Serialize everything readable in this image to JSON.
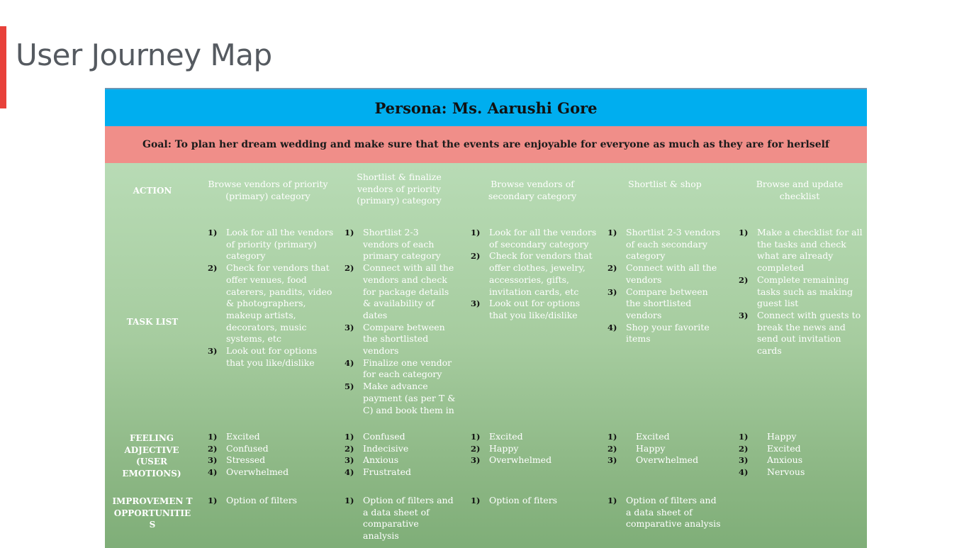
{
  "slide": {
    "title": "User Journey Map"
  },
  "persona": "Persona: Ms. Aarushi Gore",
  "goal": "Goal: To plan her dream wedding and make sure that the events are enjoyable for everyone as much as they are for herlself",
  "row_labels": {
    "action": "ACTION",
    "task_list": "TASK LIST",
    "feeling": "FEELING ADJECTIVE (USER EMOTIONS)",
    "improvement": "IMPROVEMEN T OPPORTUNITIE S"
  },
  "stages": [
    {
      "action": "Browse vendors of priority (primary) category",
      "tasks": [
        {
          "n": "1)",
          "t": "Look for all the vendors of priority (primary) category"
        },
        {
          "n": "2)",
          "t": "Check for vendors that offer venues, food caterers, pandits, video & photographers, makeup artists, decorators, music systems, etc"
        },
        {
          "n": "3)",
          "t": "Look out for options that you like/dislike"
        }
      ],
      "feelings": [
        {
          "n": "1)",
          "t": "Excited"
        },
        {
          "n": "2)",
          "t": "Confused"
        },
        {
          "n": "3)",
          "t": "Stressed"
        },
        {
          "n": "4)",
          "t": "Overwhelmed"
        }
      ],
      "improvements": [
        {
          "n": "1)",
          "t": "Option of filters"
        }
      ]
    },
    {
      "action": "Shortlist & finalize vendors of priority (primary) category",
      "tasks": [
        {
          "n": "1)",
          "t": "Shortlist 2-3 vendors of each primary category"
        },
        {
          "n": "2)",
          "t": "Connect with all the vendors and check for package details & availability of dates"
        },
        {
          "n": "3)",
          "t": "Compare between the shortlisted vendors"
        },
        {
          "n": "4)",
          "t": "Finalize one vendor for each category"
        },
        {
          "n": "5)",
          "t": "Make advance payment (as per T & C) and book them in"
        }
      ],
      "feelings": [
        {
          "n": "1)",
          "t": "Confused"
        },
        {
          "n": "2)",
          "t": "Indecisive"
        },
        {
          "n": "3)",
          "t": "Anxious"
        },
        {
          "n": "4)",
          "t": "Frustrated"
        }
      ],
      "improvements": [
        {
          "n": "1)",
          "t": "Option of filters and a data sheet of comparative analysis"
        }
      ]
    },
    {
      "action": "Browse vendors of secondary category",
      "tasks": [
        {
          "n": "1)",
          "t": "Look for all the vendors of secondary category"
        },
        {
          "n": "2)",
          "t": "Check for vendors that offer clothes, jewelry, accessories, gifts, invitation cards, etc"
        },
        {
          "n": "3)",
          "t": "Look out for options that you like/dislike"
        }
      ],
      "feelings": [
        {
          "n": "1)",
          "t": "Excited"
        },
        {
          "n": "2)",
          "t": "Happy"
        },
        {
          "n": "3)",
          "t": "Overwhelmed"
        }
      ],
      "improvements": [
        {
          "n": "1)",
          "t": "Option of fiters"
        }
      ]
    },
    {
      "action": "Shortlist & shop",
      "tasks": [
        {
          "n": "1)",
          "t": "Shortlist 2-3 vendors of each secondary category"
        },
        {
          "n": "2)",
          "t": "Connect with all the vendors"
        },
        {
          "n": "3)",
          "t": "Compare between the shortlisted vendors"
        },
        {
          "n": "4)",
          "t": "Shop your favorite items"
        }
      ],
      "feelings": [
        {
          "n": "1)",
          "t": "Excited"
        },
        {
          "n": "2)",
          "t": "Happy"
        },
        {
          "n": "3)",
          "t": "Overwhelmed"
        }
      ],
      "improvements": [
        {
          "n": "1)",
          "t": "Option of filters and a data sheet of comparative analysis"
        }
      ]
    },
    {
      "action": "Browse and update checklist",
      "tasks": [
        {
          "n": "1)",
          "t": "Make a checklist for all the tasks and check what are already completed"
        },
        {
          "n": "2)",
          "t": "Complete remaining tasks such as making guest list"
        },
        {
          "n": "3)",
          "t": "Connect with guests to break the news and send out invitation cards"
        }
      ],
      "feelings": [
        {
          "n": "1)",
          "t": "Happy"
        },
        {
          "n": "2)",
          "t": "Excited"
        },
        {
          "n": "3)",
          "t": "Anxious"
        },
        {
          "n": "4)",
          "t": "Nervous"
        }
      ],
      "improvements": []
    }
  ]
}
